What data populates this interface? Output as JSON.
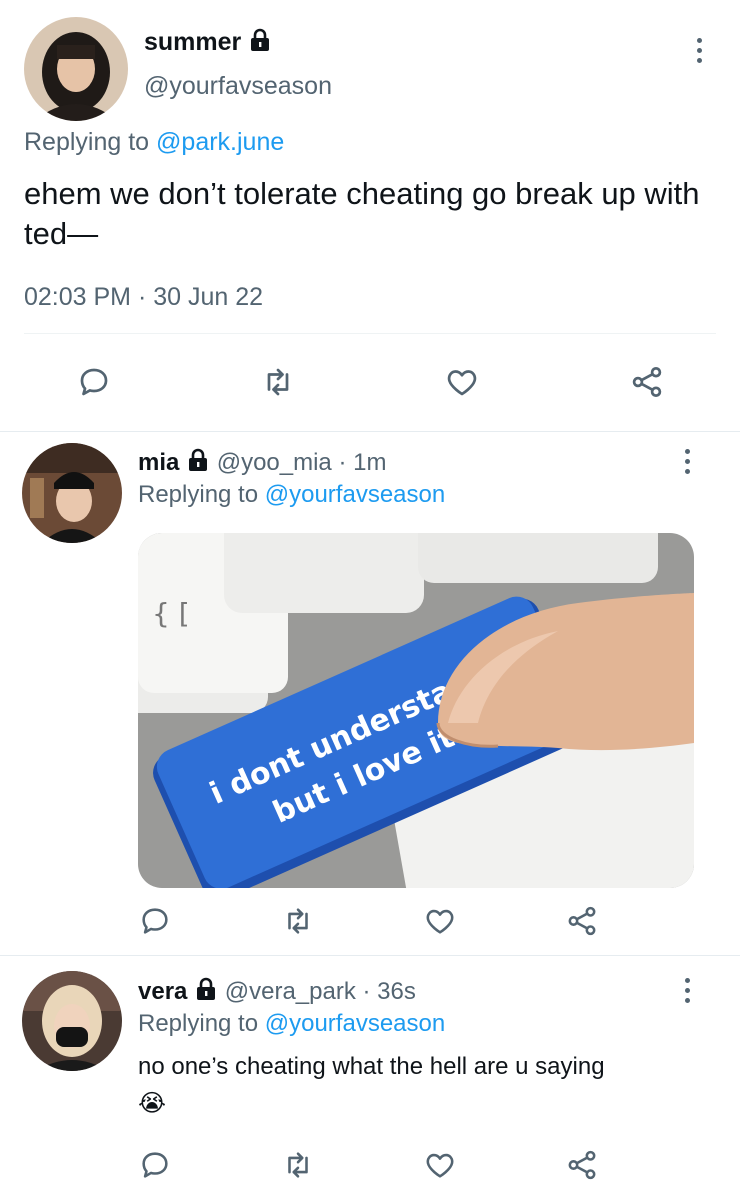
{
  "main_tweet": {
    "display_name": "summer",
    "handle": "@yourfavseason",
    "replying_prefix": "Replying to",
    "replying_to": "@park.june",
    "text": "ehem we don’t tolerate cheating go break up with ted—",
    "timestamp": "02:03 PM · 30 Jun 22"
  },
  "replies": [
    {
      "display_name": "mia",
      "handle": "@yoo_mia",
      "time": "· 1m",
      "replying_prefix": "Replying to",
      "replying_to": "@yourfavseason",
      "image_caption_line1": "i dont understand",
      "image_caption_line2": "but i love it"
    },
    {
      "display_name": "vera",
      "handle": "@vera_park",
      "time": "· 36s",
      "replying_prefix": "Replying to",
      "replying_to": "@yourfavseason",
      "text": "no one’s cheating what the hell are u saying",
      "emoji": "😭"
    }
  ],
  "icons": [
    "lock-icon",
    "more-icon",
    "reply-icon",
    "retweet-icon",
    "like-icon",
    "share-icon"
  ],
  "colors": {
    "link": "#1d9bf0",
    "muted": "#536471",
    "text": "#0f1419",
    "divider": "#eff3f4",
    "key_blue": "#2f6fd6"
  }
}
